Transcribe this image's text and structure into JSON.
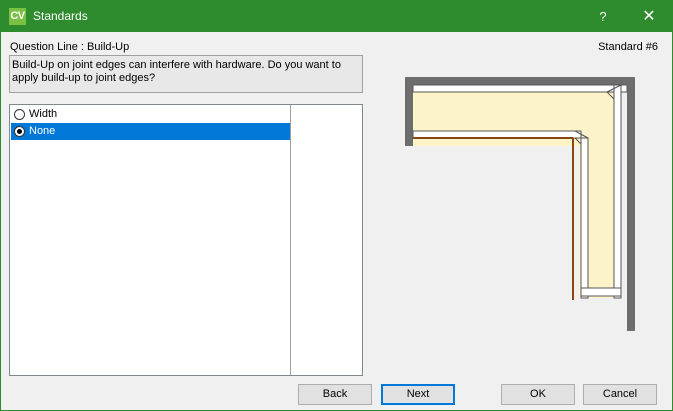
{
  "window": {
    "app_icon_text": "CV",
    "title": "Standards",
    "help_glyph": "?",
    "close_glyph": "✕"
  },
  "question": {
    "line_label": "Question Line : Build-Up",
    "standard_label": "Standard #6",
    "text": "Build-Up on joint edges can interfere with hardware. Do you want to apply build-up to joint edges?"
  },
  "options": [
    {
      "label": "Width",
      "checked": false,
      "selected": false
    },
    {
      "label": "None",
      "checked": true,
      "selected": true
    }
  ],
  "buttons": {
    "back": "Back",
    "next": "Next",
    "ok": "OK",
    "cancel": "Cancel"
  },
  "colors": {
    "titlebar": "#2e8b2e",
    "selection": "#0078d7",
    "panel_fill": "#fdf3c8",
    "wall": "#6d6d6d",
    "edge": "#8b4513"
  }
}
